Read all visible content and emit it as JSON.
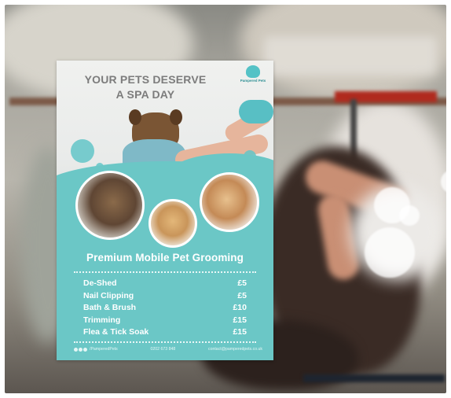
{
  "poster": {
    "headline_line1": "YOUR PETS DESERVE",
    "headline_line2": "A SPA DAY",
    "logo_text": "Pampered Pets",
    "subtitle": "Premium Mobile Pet Grooming",
    "services": [
      {
        "name": "De-Shed",
        "price": "£5"
      },
      {
        "name": "Nail Clipping",
        "price": "£5"
      },
      {
        "name": "Bath & Brush",
        "price": "£10"
      },
      {
        "name": "Trimming",
        "price": "£15"
      },
      {
        "name": "Flea & Tick Soak",
        "price": "£15"
      }
    ],
    "footer": {
      "social_handle": "/PamperedPets",
      "phone": "0202 673 848",
      "email": "contact@pamperedpets.co.uk"
    }
  },
  "colors": {
    "teal": "#6bc7c6",
    "headline_gray": "#7c7c7c",
    "text_white": "#ffffff"
  }
}
